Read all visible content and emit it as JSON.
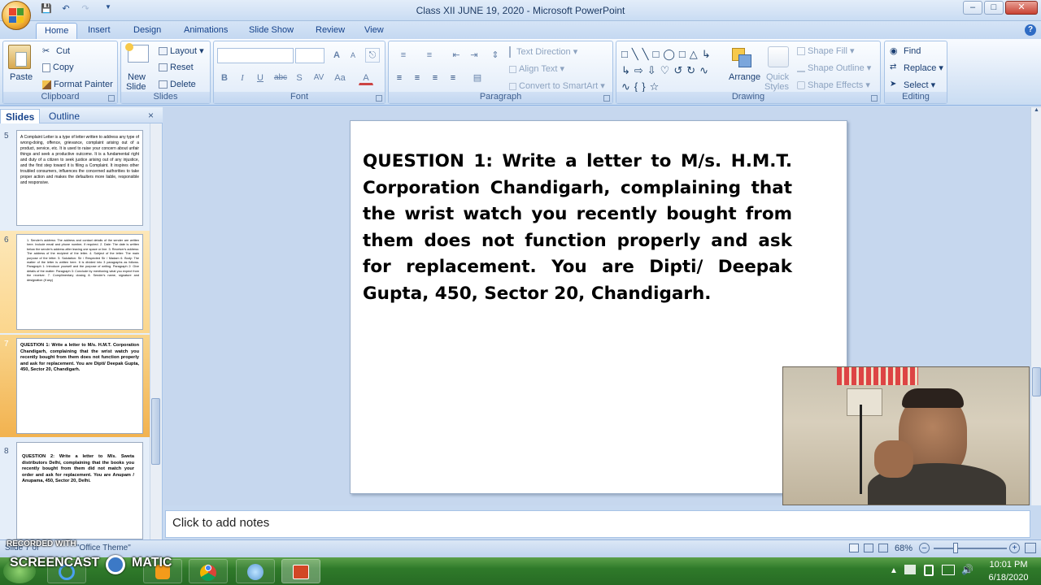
{
  "window": {
    "title": "Class XII JUNE 19, 2020 - Microsoft PowerPoint",
    "controls": {
      "minimize": "–",
      "maximize": "□",
      "close": "✕"
    }
  },
  "quick_access": [
    "save-icon",
    "undo-icon",
    "redo-icon",
    "customize-icon"
  ],
  "tabs": [
    "Home",
    "Insert",
    "Design",
    "Animations",
    "Slide Show",
    "Review",
    "View"
  ],
  "active_tab": "Home",
  "ribbon": {
    "clipboard": {
      "label": "Clipboard",
      "paste": "Paste",
      "cut": "Cut",
      "copy": "Copy",
      "format_painter": "Format Painter"
    },
    "slides": {
      "label": "Slides",
      "new_slide": "New",
      "new_slide2": "Slide",
      "layout": "Layout",
      "reset": "Reset",
      "delete": "Delete"
    },
    "font": {
      "label": "Font",
      "bold": "B",
      "italic": "I",
      "underline": "U",
      "strike": "abc",
      "shadow": "S",
      "spacing": "AV",
      "case": "Aa",
      "color": "A",
      "grow": "A",
      "shrink": "A"
    },
    "paragraph": {
      "label": "Paragraph",
      "text_direction": "Text Direction",
      "align_text": "Align Text",
      "convert_smartart": "Convert to SmartArt"
    },
    "drawing": {
      "label": "Drawing",
      "arrange": "Arrange",
      "quick_styles": "Quick",
      "quick_styles2": "Styles",
      "shape_fill": "Shape Fill",
      "shape_outline": "Shape Outline",
      "shape_effects": "Shape Effects"
    },
    "editing": {
      "label": "Editing",
      "find": "Find",
      "replace": "Replace",
      "select": "Select"
    }
  },
  "left_pane": {
    "tabs": [
      "Slides",
      "Outline"
    ],
    "close": "×",
    "slides": [
      {
        "number": "5",
        "text": "A Complaint Letter is a type of letter written to address any type of wrong-doing, offence, grievance, complaint arising out of a product, service, etc. It is used to raise your concern about unfair things and seek a productive outcome. It is a fundamental right and duty of a citizen to seek justice arising out of any injustice, and the first step toward it is filing a Complaint. It inspires other troubled consumers, influences the concerned authorities to take proper action and makes the defaulters more liable, responsible and responsive."
      },
      {
        "number": "6",
        "text": "1. Sender's address: The address and contact details of the sender are written here. Include email and phone number, if required. 2. Date: The date is written below the sender's address after leaving one space or line. 3. Receiver's address: The address of the recipient of the letter. 4. Subject of the letter: The main purpose of the letter. 5. Salutation: Sir / Respected Sir / Madam 6. Body: The matter of the letter is written here. It is divided into 3 paragraphs as follows. Paragraph 1: Introduce yourself and the purpose of writing. Paragraph 2: Give details of the matter. Paragraph 3: Conclude by mentioning what you expect from the receiver. 7. Complimentary closing 8. Sender's name, signature and designation (if any)"
      },
      {
        "number": "7",
        "text": "QUESTION 1: Write a letter to M/s. H.M.T. Corporation Chandigarh, complaining that the wrist watch you recently bought from them does not function properly and ask for replacement. You are Dipti/ Deepak Gupta, 450, Sector 20, Chandigarh."
      },
      {
        "number": "8",
        "text": "QUESTION 2: Write a letter to M/s. Sweta distributors Delhi, complaining that the books you recently bought from them did not match your order and ask for replacement. You are Anupam / Anupama, 450, Sector 20, Delhi."
      }
    ]
  },
  "slide": {
    "text": "QUESTION 1: Write a letter to M/s. H.M.T. Corporation Chandigarh, complaining that the wrist watch you recently bought from them does not function properly and ask for replacement. You are Dipti/ Deepak Gupta, 450, Sector 20, Chandigarh."
  },
  "notes": {
    "placeholder": "Click to add notes"
  },
  "status_bar": {
    "slide_info": "Slide 7 of",
    "theme": "\"Office Theme\"",
    "zoom": "68%",
    "zoom_out": "–",
    "zoom_in": "+"
  },
  "watermark": {
    "line1": "RECORDED WITH",
    "line2": "SCREENCAST",
    "line3": "MATIC"
  },
  "taskbar": {
    "apps": [
      "ie-icon",
      "media-player-icon",
      "chrome-icon",
      "blank-app-icon",
      "powerpoint-icon"
    ],
    "time": "10:01 PM",
    "date": "6/18/2020"
  },
  "colors": {
    "accent": "#15428b",
    "ribbon_bg": "#dce8f7",
    "selected_thumb": "#f2b24f",
    "taskbar": "#2f7a2a"
  }
}
